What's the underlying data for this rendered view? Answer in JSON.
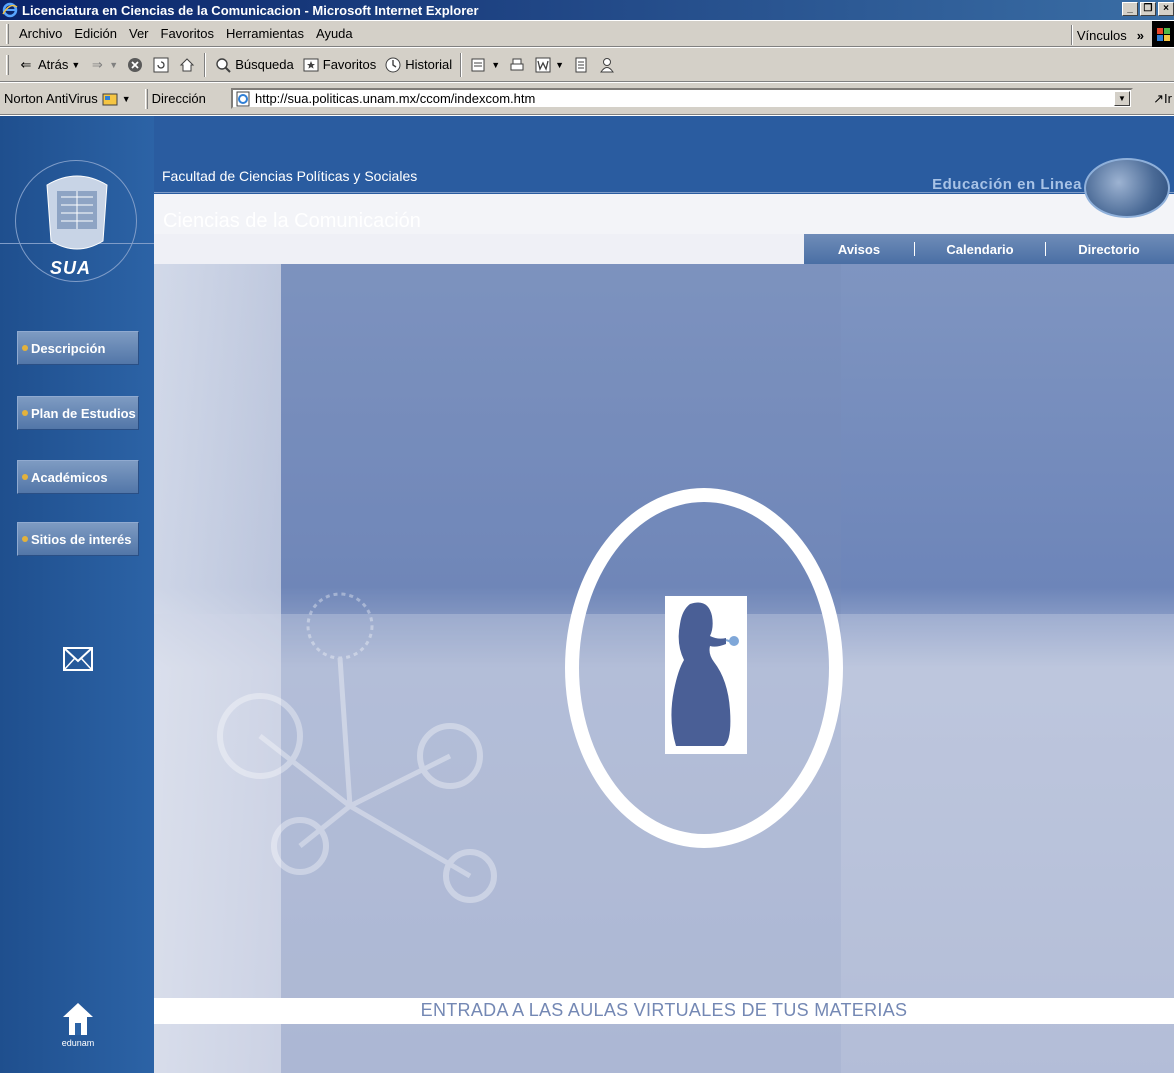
{
  "window": {
    "title": "Licenciatura en Ciencias de la Comunicacion - Microsoft Internet Explorer",
    "controls": [
      "_",
      "❐",
      "×"
    ]
  },
  "menubar": {
    "items": [
      {
        "label": "Archivo"
      },
      {
        "label": "Edición"
      },
      {
        "label": "Ver"
      },
      {
        "label": "Favoritos"
      },
      {
        "label": "Herramientas"
      },
      {
        "label": "Ayuda"
      }
    ],
    "links_label": "Vínculos",
    "chevron": "»"
  },
  "toolbar": {
    "back_label": "Atrás",
    "search_label": "Búsqueda",
    "favorites_label": "Favoritos",
    "history_label": "Historial"
  },
  "addressbar": {
    "norton_label": "Norton AntiVirus",
    "address_label": "Dirección",
    "url": "http://sua.politicas.unam.mx/ccom/indexcom.htm",
    "go_label": "Ir"
  },
  "page": {
    "faculty": "Facultad de Ciencias Políticas y Sociales",
    "educacion": "Educación en Linea",
    "section_title": "Ciencias de la Comunicación",
    "logo_text": "SUA",
    "top_nav": [
      {
        "label": "Avisos"
      },
      {
        "label": "Calendario"
      },
      {
        "label": "Directorio"
      }
    ],
    "side_nav": [
      {
        "label": "Descripción"
      },
      {
        "label": "Plan de Estudios"
      },
      {
        "label": "Académicos"
      },
      {
        "label": "Sitios de interés"
      }
    ],
    "entry_text": "ENTRADA A LAS AULAS VIRTUALES DE TUS MATERIAS",
    "home_label": "edunam"
  },
  "colors": {
    "sidebar": "#2c63a6",
    "header": "#2a5ca0",
    "hero": "#7f95c1",
    "bullet": "#e3b23c"
  }
}
